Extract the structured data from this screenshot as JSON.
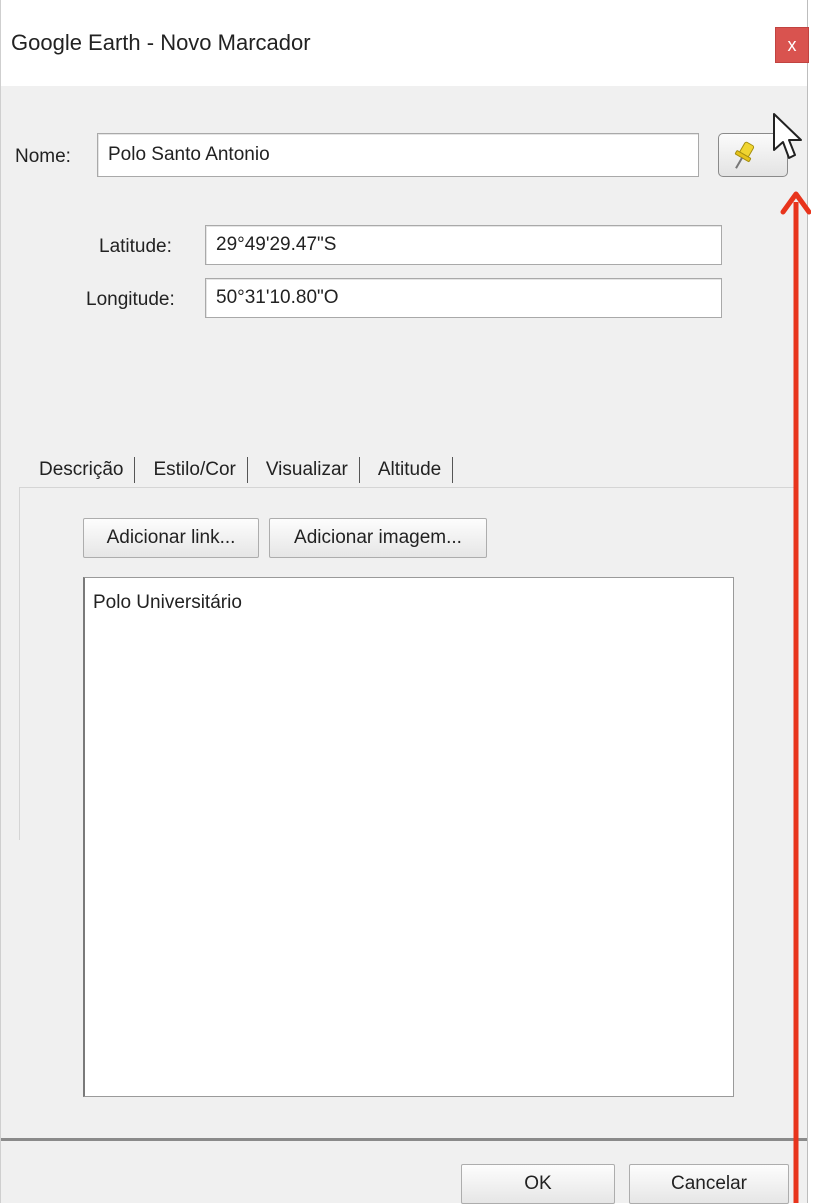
{
  "window": {
    "title": "Google Earth - Novo Marcador",
    "close_glyph": "x",
    "close_color": "#d9534f"
  },
  "form": {
    "name_label": "Nome:",
    "name_value": "Polo Santo Antonio",
    "latitude_label": "Latitude:",
    "latitude_value": "29°49'29.47\"S",
    "longitude_label": "Longitude:",
    "longitude_value": "50°31'10.80\"O",
    "pin_icon": "pushpin-icon"
  },
  "tabs": [
    {
      "label": "Descrição",
      "active": true
    },
    {
      "label": "Estilo/Cor",
      "active": false
    },
    {
      "label": "Visualizar",
      "active": false
    },
    {
      "label": "Altitude",
      "active": false
    }
  ],
  "description": {
    "add_link_label": "Adicionar link...",
    "add_image_label": "Adicionar imagem...",
    "text": "Polo Universitário"
  },
  "footer": {
    "ok_label": "OK",
    "cancel_label": "Cancelar"
  },
  "annotation": {
    "arrow_color": "#e8341c"
  }
}
